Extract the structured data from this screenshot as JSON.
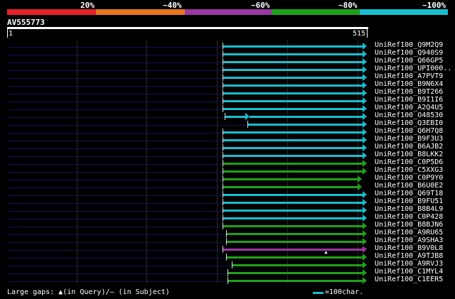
{
  "identity_scale": {
    "labels": [
      "20%",
      "~40%",
      "~60%",
      "~80%",
      "~100%"
    ],
    "colors": [
      "#e8202a",
      "#e8781e",
      "#9a38a5",
      "#1fa11a",
      "#17becf"
    ]
  },
  "query": {
    "name": "AV555773",
    "start": "1",
    "end": "515"
  },
  "hits": [
    {
      "label": "UniRef100_Q9M2Q9",
      "start": 312,
      "end": 515,
      "color": "#17becf",
      "arrow": true
    },
    {
      "label": "UniRef100_Q940S9",
      "start": 312,
      "end": 515,
      "color": "#17becf",
      "arrow": true
    },
    {
      "label": "UniRef100_Q66GP5",
      "start": 312,
      "end": 515,
      "color": "#17becf",
      "arrow": true
    },
    {
      "label": "UniRef100_UPI000..",
      "start": 312,
      "end": 515,
      "color": "#17becf",
      "arrow": true
    },
    {
      "label": "UniRef100_A7PVT9",
      "start": 312,
      "end": 515,
      "color": "#17becf",
      "arrow": true
    },
    {
      "label": "UniRef100_B9N6X4",
      "start": 312,
      "end": 515,
      "color": "#17becf",
      "arrow": true
    },
    {
      "label": "UniRef100_B9T266",
      "start": 312,
      "end": 515,
      "color": "#17becf",
      "arrow": true
    },
    {
      "label": "UniRef100_B9I1I6",
      "start": 312,
      "end": 515,
      "color": "#17becf",
      "arrow": true
    },
    {
      "label": "UniRef100_A2Q4U5",
      "start": 312,
      "end": 515,
      "color": "#17becf",
      "arrow": true
    },
    {
      "label": "UniRef100_O48530",
      "start": 316,
      "end": 515,
      "color": "#17becf",
      "arrow": true,
      "pieces": [
        [
          316,
          345
        ],
        [
          352,
          515
        ]
      ],
      "mid_arrow": 345
    },
    {
      "label": "UniRef100_Q3EBI0",
      "start": 348,
      "end": 515,
      "color": "#17becf",
      "arrow": true
    },
    {
      "label": "UniRef100_Q6H7Q8",
      "start": 312,
      "end": 515,
      "color": "#17becf",
      "arrow": true
    },
    {
      "label": "UniRef100_B9F3U3",
      "start": 312,
      "end": 515,
      "color": "#17becf",
      "arrow": true
    },
    {
      "label": "UniRef100_B6AJB2",
      "start": 312,
      "end": 515,
      "color": "#17becf",
      "arrow": true
    },
    {
      "label": "UniRef100_B8LKK2",
      "start": 312,
      "end": 515,
      "color": "#17becf",
      "arrow": true
    },
    {
      "label": "UniRef100_C0P5D6",
      "start": 312,
      "end": 515,
      "color": "#1fa11a",
      "arrow": true
    },
    {
      "label": "UniRef100_C5XXG3",
      "start": 312,
      "end": 515,
      "color": "#1fa11a",
      "arrow": true
    },
    {
      "label": "UniRef100_C0P9Y0",
      "start": 312,
      "end": 508,
      "color": "#1fa11a",
      "arrow": true
    },
    {
      "label": "UniRef100_B6U0E2",
      "start": 312,
      "end": 508,
      "color": "#1fa11a",
      "arrow": true
    },
    {
      "label": "UniRef100_Q69T18",
      "start": 312,
      "end": 515,
      "color": "#17becf",
      "arrow": true
    },
    {
      "label": "UniRef100_B9FU51",
      "start": 312,
      "end": 515,
      "color": "#17becf",
      "arrow": true
    },
    {
      "label": "UniRef100_B8B4L9",
      "start": 312,
      "end": 515,
      "color": "#17becf",
      "arrow": true
    },
    {
      "label": "UniRef100_C0P428",
      "start": 312,
      "end": 515,
      "color": "#17becf",
      "arrow": true
    },
    {
      "label": "UniRef100_B8BJN6",
      "start": 312,
      "end": 515,
      "color": "#1fa11a",
      "arrow": true
    },
    {
      "label": "UniRef100_A9RU65",
      "start": 318,
      "end": 515,
      "color": "#1fa11a",
      "arrow": true
    },
    {
      "label": "UniRef100_A9SHA3",
      "start": 318,
      "end": 515,
      "color": "#1fa11a",
      "arrow": true
    },
    {
      "label": "UniRef100_B9V0L8",
      "start": 312,
      "end": 515,
      "color": "#9a38a5",
      "arrow": true,
      "gap_at": 463
    },
    {
      "label": "UniRef100_A9TJB8",
      "start": 318,
      "end": 515,
      "color": "#1fa11a",
      "arrow": true
    },
    {
      "label": "UniRef100_A9RVJ3",
      "start": 326,
      "end": 515,
      "color": "#1fa11a",
      "arrow": true
    },
    {
      "label": "UniRef100_C1MYL4",
      "start": 320,
      "end": 515,
      "color": "#1fa11a",
      "arrow": true
    },
    {
      "label": "UniRef100_C1EER5",
      "start": 320,
      "end": 515,
      "color": "#1fa11a",
      "arrow": true
    }
  ],
  "footer": {
    "gaps_text": "Large gaps: ▲(in Query)/— (in Subject)",
    "legend_text": "=100char."
  }
}
